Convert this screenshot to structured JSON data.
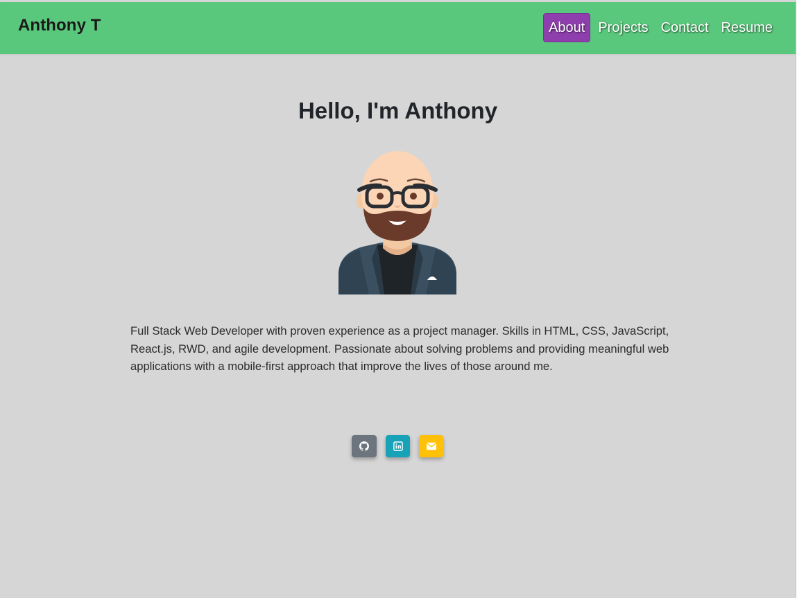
{
  "navbar": {
    "brand": "Anthony T",
    "links": [
      {
        "label": "About",
        "active": true
      },
      {
        "label": "Projects",
        "active": false
      },
      {
        "label": "Contact",
        "active": false
      },
      {
        "label": "Resume",
        "active": false
      }
    ]
  },
  "hero": {
    "title": "Hello, I'm Anthony",
    "avatar_icon": "bearded-man-avatar",
    "bio": "Full Stack Web Developer with proven experience as a project manager. Skills in HTML, CSS, JavaScript, React.js, RWD, and agile development. Passionate about solving problems and providing meaningful web applications with a mobile-first approach that improve the lives of those around me."
  },
  "socials": [
    {
      "icon": "github-icon",
      "color": "#6c757d"
    },
    {
      "icon": "linkedin-icon",
      "color": "#17a2b8"
    },
    {
      "icon": "email-icon",
      "color": "#ffc107"
    }
  ],
  "colors": {
    "navbar_bg": "#5ac87c",
    "active_nav_bg": "#8e3fad",
    "page_bg": "#d6d6d6"
  }
}
